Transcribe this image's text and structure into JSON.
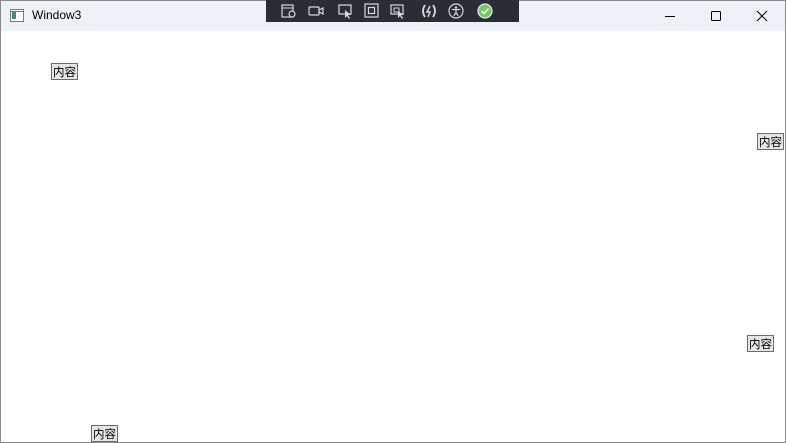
{
  "window": {
    "title": "Window3"
  },
  "caption_buttons": {
    "minimize": "minimize-icon",
    "maximize": "maximize-icon",
    "close": "close-icon"
  },
  "debug_toolbar": {
    "icons": [
      "live-visual-tree-icon",
      "record-icon",
      "select-element-icon",
      "display-layout-adorners-icon",
      "track-focus-icon",
      "hot-reload-icon",
      "accessibility-icon",
      "check-icon"
    ],
    "check_color": "#6ecb63"
  },
  "content": {
    "labels": [
      "内容",
      "内容",
      "内容",
      "内容"
    ]
  }
}
